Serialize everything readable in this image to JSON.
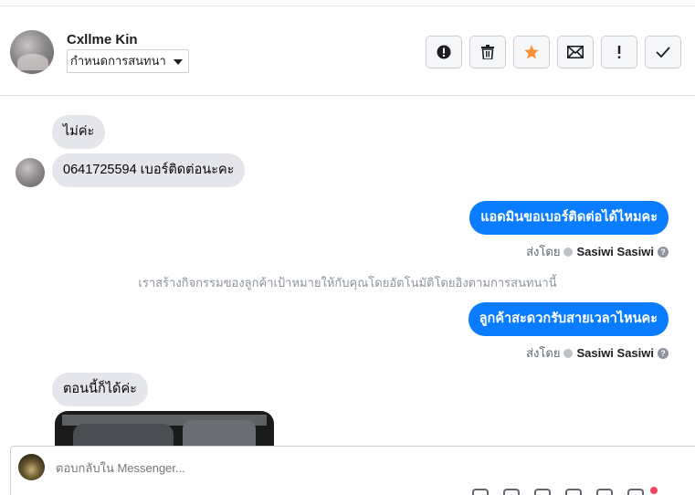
{
  "contact": {
    "name": "Cxllme Kin",
    "status_label": "กำหนดการสนทนา"
  },
  "toolbar": {
    "buttons": [
      {
        "icon": "alert-circle-icon"
      },
      {
        "icon": "trash-icon"
      },
      {
        "icon": "star-icon",
        "color": "#f7923b"
      },
      {
        "icon": "envelope-icon"
      },
      {
        "icon": "exclamation-icon"
      },
      {
        "icon": "check-icon"
      }
    ]
  },
  "messages": {
    "m1": "ไม่ค่ะ",
    "m2": "0641725594 เบอร์ติดต่อนะคะ",
    "m3": "แอดมินขอเบอร์ติดต่อได้ไหมคะ",
    "m4": "ลูกค้าสะดวกรับสายเวลาไหนคะ",
    "m5": "ตอนนี้ก็ได้ค่ะ"
  },
  "sent_by": {
    "label": "ส่งโดย",
    "sender": "Sasiwi Sasiwi"
  },
  "system_note": "เราสร้างกิจกรรมของลูกค้าเป้าหมายให้กับคุณโดยอัตโนมัติโดยอิงตามการสนทนานี้",
  "composer": {
    "placeholder": "ตอบกลับใน Messenger..."
  },
  "colors": {
    "outgoing_bubble": "#0a7cff",
    "incoming_bubble": "#e4e6eb",
    "star": "#f7923b"
  }
}
